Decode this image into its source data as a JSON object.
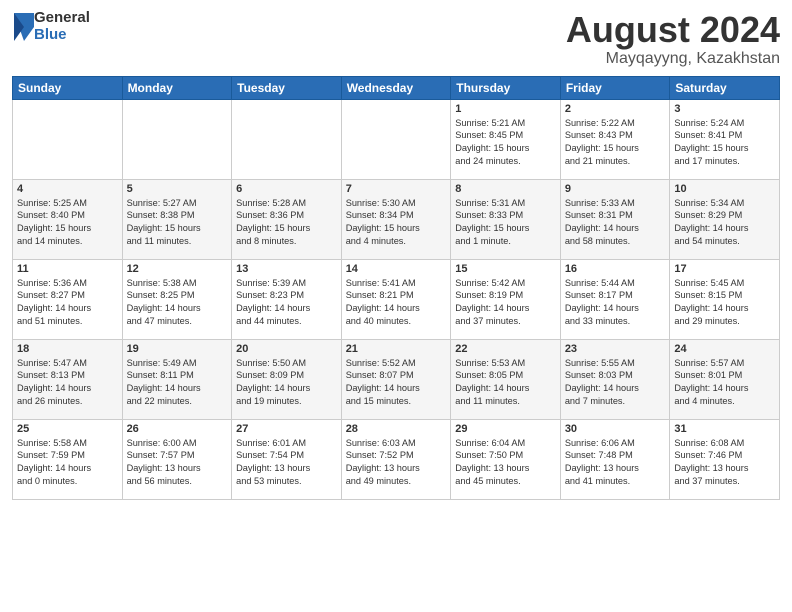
{
  "logo": {
    "general": "General",
    "blue": "Blue"
  },
  "title": {
    "month_year": "August 2024",
    "location": "Mayqayyng, Kazakhstan"
  },
  "weekdays": [
    "Sunday",
    "Monday",
    "Tuesday",
    "Wednesday",
    "Thursday",
    "Friday",
    "Saturday"
  ],
  "weeks": [
    [
      {
        "day": "",
        "info": ""
      },
      {
        "day": "",
        "info": ""
      },
      {
        "day": "",
        "info": ""
      },
      {
        "day": "",
        "info": ""
      },
      {
        "day": "1",
        "info": "Sunrise: 5:21 AM\nSunset: 8:45 PM\nDaylight: 15 hours\nand 24 minutes."
      },
      {
        "day": "2",
        "info": "Sunrise: 5:22 AM\nSunset: 8:43 PM\nDaylight: 15 hours\nand 21 minutes."
      },
      {
        "day": "3",
        "info": "Sunrise: 5:24 AM\nSunset: 8:41 PM\nDaylight: 15 hours\nand 17 minutes."
      }
    ],
    [
      {
        "day": "4",
        "info": "Sunrise: 5:25 AM\nSunset: 8:40 PM\nDaylight: 15 hours\nand 14 minutes."
      },
      {
        "day": "5",
        "info": "Sunrise: 5:27 AM\nSunset: 8:38 PM\nDaylight: 15 hours\nand 11 minutes."
      },
      {
        "day": "6",
        "info": "Sunrise: 5:28 AM\nSunset: 8:36 PM\nDaylight: 15 hours\nand 8 minutes."
      },
      {
        "day": "7",
        "info": "Sunrise: 5:30 AM\nSunset: 8:34 PM\nDaylight: 15 hours\nand 4 minutes."
      },
      {
        "day": "8",
        "info": "Sunrise: 5:31 AM\nSunset: 8:33 PM\nDaylight: 15 hours\nand 1 minute."
      },
      {
        "day": "9",
        "info": "Sunrise: 5:33 AM\nSunset: 8:31 PM\nDaylight: 14 hours\nand 58 minutes."
      },
      {
        "day": "10",
        "info": "Sunrise: 5:34 AM\nSunset: 8:29 PM\nDaylight: 14 hours\nand 54 minutes."
      }
    ],
    [
      {
        "day": "11",
        "info": "Sunrise: 5:36 AM\nSunset: 8:27 PM\nDaylight: 14 hours\nand 51 minutes."
      },
      {
        "day": "12",
        "info": "Sunrise: 5:38 AM\nSunset: 8:25 PM\nDaylight: 14 hours\nand 47 minutes."
      },
      {
        "day": "13",
        "info": "Sunrise: 5:39 AM\nSunset: 8:23 PM\nDaylight: 14 hours\nand 44 minutes."
      },
      {
        "day": "14",
        "info": "Sunrise: 5:41 AM\nSunset: 8:21 PM\nDaylight: 14 hours\nand 40 minutes."
      },
      {
        "day": "15",
        "info": "Sunrise: 5:42 AM\nSunset: 8:19 PM\nDaylight: 14 hours\nand 37 minutes."
      },
      {
        "day": "16",
        "info": "Sunrise: 5:44 AM\nSunset: 8:17 PM\nDaylight: 14 hours\nand 33 minutes."
      },
      {
        "day": "17",
        "info": "Sunrise: 5:45 AM\nSunset: 8:15 PM\nDaylight: 14 hours\nand 29 minutes."
      }
    ],
    [
      {
        "day": "18",
        "info": "Sunrise: 5:47 AM\nSunset: 8:13 PM\nDaylight: 14 hours\nand 26 minutes."
      },
      {
        "day": "19",
        "info": "Sunrise: 5:49 AM\nSunset: 8:11 PM\nDaylight: 14 hours\nand 22 minutes."
      },
      {
        "day": "20",
        "info": "Sunrise: 5:50 AM\nSunset: 8:09 PM\nDaylight: 14 hours\nand 19 minutes."
      },
      {
        "day": "21",
        "info": "Sunrise: 5:52 AM\nSunset: 8:07 PM\nDaylight: 14 hours\nand 15 minutes."
      },
      {
        "day": "22",
        "info": "Sunrise: 5:53 AM\nSunset: 8:05 PM\nDaylight: 14 hours\nand 11 minutes."
      },
      {
        "day": "23",
        "info": "Sunrise: 5:55 AM\nSunset: 8:03 PM\nDaylight: 14 hours\nand 7 minutes."
      },
      {
        "day": "24",
        "info": "Sunrise: 5:57 AM\nSunset: 8:01 PM\nDaylight: 14 hours\nand 4 minutes."
      }
    ],
    [
      {
        "day": "25",
        "info": "Sunrise: 5:58 AM\nSunset: 7:59 PM\nDaylight: 14 hours\nand 0 minutes."
      },
      {
        "day": "26",
        "info": "Sunrise: 6:00 AM\nSunset: 7:57 PM\nDaylight: 13 hours\nand 56 minutes."
      },
      {
        "day": "27",
        "info": "Sunrise: 6:01 AM\nSunset: 7:54 PM\nDaylight: 13 hours\nand 53 minutes."
      },
      {
        "day": "28",
        "info": "Sunrise: 6:03 AM\nSunset: 7:52 PM\nDaylight: 13 hours\nand 49 minutes."
      },
      {
        "day": "29",
        "info": "Sunrise: 6:04 AM\nSunset: 7:50 PM\nDaylight: 13 hours\nand 45 minutes."
      },
      {
        "day": "30",
        "info": "Sunrise: 6:06 AM\nSunset: 7:48 PM\nDaylight: 13 hours\nand 41 minutes."
      },
      {
        "day": "31",
        "info": "Sunrise: 6:08 AM\nSunset: 7:46 PM\nDaylight: 13 hours\nand 37 minutes."
      }
    ]
  ]
}
